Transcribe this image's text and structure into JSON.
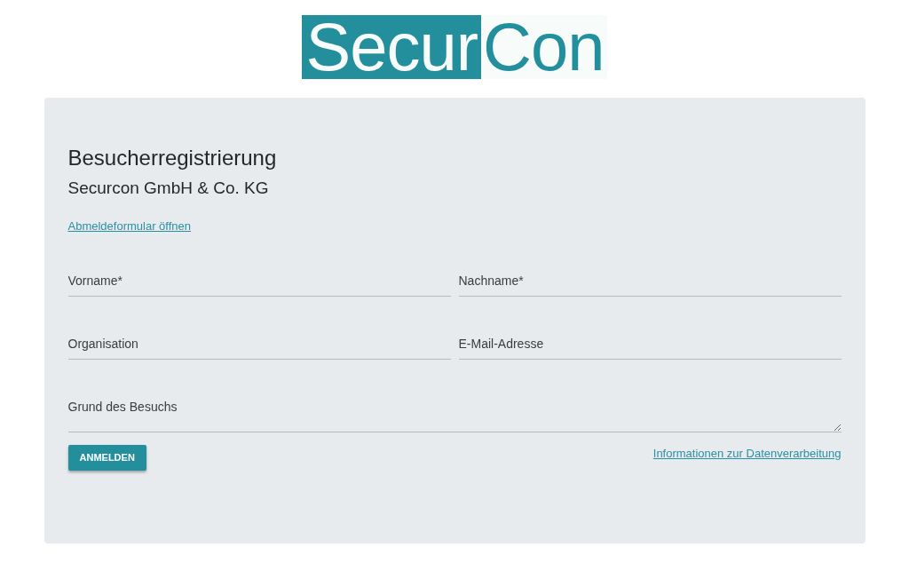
{
  "logo": {
    "highlighted": "Secur",
    "plain": "Con"
  },
  "form": {
    "title": "Besucherregistrierung",
    "subtitle": "Securcon GmbH & Co. KG",
    "deregister_link": "Abmeldeformular öffnen",
    "fields": [
      {
        "kind": "input",
        "placeholder": "Vorname*"
      },
      {
        "kind": "input",
        "placeholder": "Nachname*"
      },
      {
        "kind": "input",
        "placeholder": "Organisation"
      },
      {
        "kind": "input",
        "placeholder": "E-Mail-Adresse"
      },
      {
        "kind": "textarea",
        "placeholder": "Grund des Besuchs"
      }
    ],
    "submit_button": "ANMELDEN",
    "privacy_link": "Informationen zur Datenverarbeitung"
  }
}
